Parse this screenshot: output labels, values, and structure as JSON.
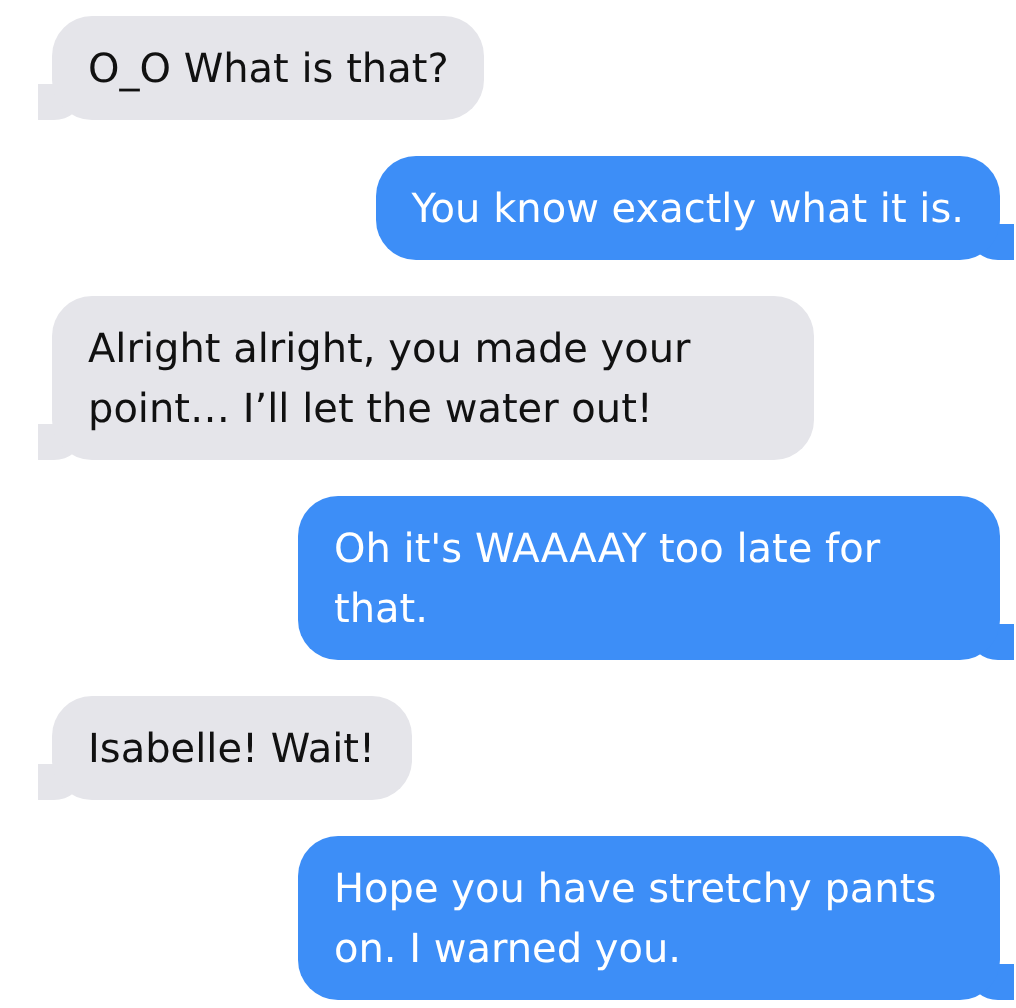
{
  "messages": [
    {
      "kind": "received",
      "text": "O_O What is that?"
    },
    {
      "kind": "sent",
      "text": "You know exactly what it is."
    },
    {
      "kind": "received",
      "text": "Alright alright, you made your point… I’ll let the water out!"
    },
    {
      "kind": "sent",
      "text": "Oh it's WAAAAY too late for that."
    },
    {
      "kind": "received",
      "text": "Isabelle! Wait!"
    },
    {
      "kind": "sent",
      "text": "Hope you have stretchy pants on. I warned you."
    }
  ]
}
